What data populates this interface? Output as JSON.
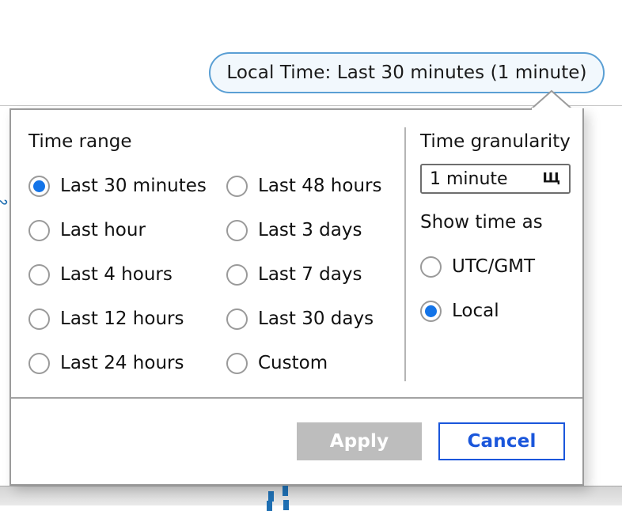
{
  "background": {
    "side_icon": "curly-decoration",
    "dash_marker": "dashed-selection-marker"
  },
  "trigger": {
    "label": "Local Time: Last 30 minutes (1 minute)",
    "border_color": "#5a9fd4",
    "background_color": "#f2f8fd"
  },
  "popup": {
    "time_range": {
      "title": "Time range",
      "column_one": [
        {
          "label": "Last 30 minutes",
          "selected": true
        },
        {
          "label": "Last hour",
          "selected": false
        },
        {
          "label": "Last 4 hours",
          "selected": false
        },
        {
          "label": "Last 12 hours",
          "selected": false
        },
        {
          "label": "Last 24 hours",
          "selected": false
        }
      ],
      "column_two": [
        {
          "label": "Last 48 hours",
          "selected": false
        },
        {
          "label": "Last 3 days",
          "selected": false
        },
        {
          "label": "Last 7 days",
          "selected": false
        },
        {
          "label": "Last 30 days",
          "selected": false
        },
        {
          "label": "Custom",
          "selected": false
        }
      ]
    },
    "granularity": {
      "title": "Time granularity",
      "selected": "1 minute",
      "chevron": "chevron-down-icon"
    },
    "show_time_as": {
      "title": "Show time as",
      "options": [
        {
          "label": "UTC/GMT",
          "selected": false
        },
        {
          "label": "Local",
          "selected": true
        }
      ]
    },
    "footer": {
      "apply_label": "Apply",
      "cancel_label": "Cancel",
      "apply_color": "#bdbdbd",
      "cancel_color": "#1a56db"
    }
  }
}
